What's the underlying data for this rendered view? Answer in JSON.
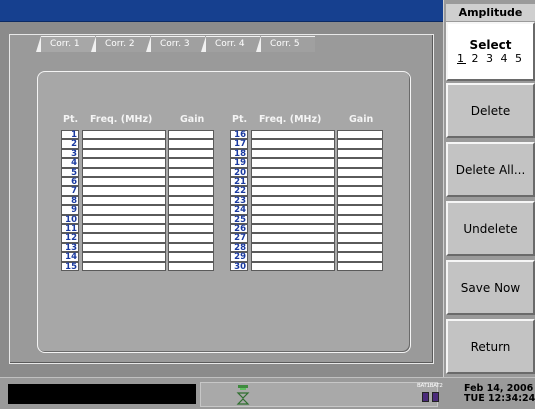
{
  "menu": {
    "title": "Amplitude",
    "select": {
      "label": "Select",
      "numbers": "1 2 3 4 5",
      "underlined": "1"
    },
    "delete": "Delete",
    "delete_all": "Delete All...",
    "undelete": "Undelete",
    "save_now": "Save Now",
    "return": "Return"
  },
  "tabs": [
    "Corr. 1",
    "Corr. 2",
    "Corr. 3",
    "Corr. 4",
    "Corr. 5"
  ],
  "table": {
    "headers": {
      "pt": "Pt.",
      "freq": "Freq. (MHz)",
      "gain": "Gain"
    },
    "left_points": [
      "1",
      "2",
      "3",
      "4",
      "5",
      "6",
      "7",
      "8",
      "9",
      "10",
      "11",
      "12",
      "13",
      "14",
      "15"
    ],
    "right_points": [
      "16",
      "17",
      "18",
      "19",
      "20",
      "21",
      "22",
      "23",
      "24",
      "25",
      "26",
      "27",
      "28",
      "29",
      "30"
    ]
  },
  "status": {
    "battery_label": "BAT1BAT2",
    "date": "Feb 14, 2006",
    "time": "TUE 12:34:24"
  },
  "colors": {
    "title_bar": "#16408f",
    "point_number": "#1a3aa0",
    "selected_key": "#ffffff"
  }
}
